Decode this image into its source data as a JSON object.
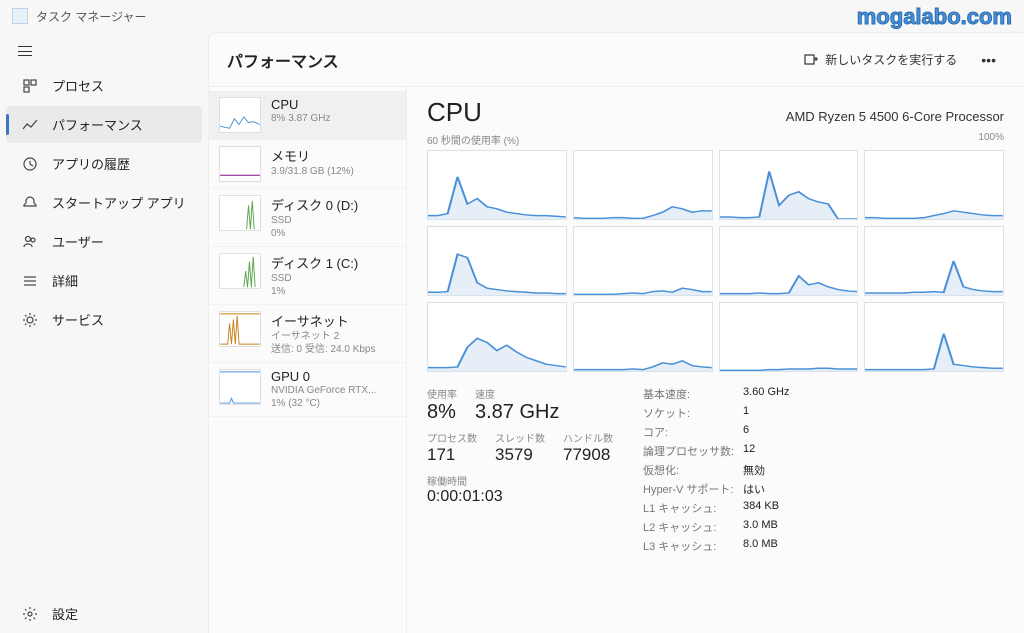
{
  "watermark": "mogalabo.com",
  "titlebar": {
    "title": "タスク マネージャー"
  },
  "sidebar": {
    "items": [
      {
        "label": "プロセス"
      },
      {
        "label": "パフォーマンス"
      },
      {
        "label": "アプリの履歴"
      },
      {
        "label": "スタートアップ アプリ"
      },
      {
        "label": "ユーザー"
      },
      {
        "label": "詳細"
      },
      {
        "label": "サービス"
      }
    ],
    "settings": "設定"
  },
  "header": {
    "title": "パフォーマンス",
    "new_task": "新しいタスクを実行する"
  },
  "resources": [
    {
      "name": "CPU",
      "sub": "8%  3.87 GHz"
    },
    {
      "name": "メモリ",
      "sub": "3.9/31.8 GB (12%)"
    },
    {
      "name": "ディスク 0 (D:)",
      "sub1": "SSD",
      "sub2": "0%"
    },
    {
      "name": "ディスク 1 (C:)",
      "sub1": "SSD",
      "sub2": "1%"
    },
    {
      "name": "イーサネット",
      "sub1": "イーサネット 2",
      "sub2": "送信: 0 受信: 24.0 Kbps"
    },
    {
      "name": "GPU 0",
      "sub1": "NVIDIA GeForce RTX...",
      "sub2": "1% (32 °C)"
    }
  ],
  "detail": {
    "title": "CPU",
    "model": "AMD Ryzen 5 4500 6-Core Processor",
    "graph_left": "60 秒間の使用率 (%)",
    "graph_right": "100%",
    "big_stats": [
      {
        "label": "使用率",
        "value": "8%"
      },
      {
        "label": "速度",
        "value": "3.87 GHz"
      }
    ],
    "mid_stats": [
      {
        "label": "プロセス数",
        "value": "171"
      },
      {
        "label": "スレッド数",
        "value": "3579"
      },
      {
        "label": "ハンドル数",
        "value": "77908"
      }
    ],
    "uptime_label": "稼働時間",
    "uptime_value": "0:00:01:03",
    "specs": [
      {
        "key": "基本速度:",
        "val": "3.60 GHz"
      },
      {
        "key": "ソケット:",
        "val": "1"
      },
      {
        "key": "コア:",
        "val": "6"
      },
      {
        "key": "論理プロセッサ数:",
        "val": "12"
      },
      {
        "key": "仮想化:",
        "val": "無効"
      },
      {
        "key": "Hyper-V サポート:",
        "val": "はい"
      },
      {
        "key": "L1 キャッシュ:",
        "val": "384 KB"
      },
      {
        "key": "L2 キャッシュ:",
        "val": "3.0 MB"
      },
      {
        "key": "L3 キャッシュ:",
        "val": "8.0 MB"
      }
    ]
  },
  "chart_data": {
    "type": "line",
    "title": "CPU per-core usage over 60 seconds",
    "xlabel": "seconds",
    "ylabel": "usage %",
    "ylim": [
      0,
      100
    ],
    "series": [
      {
        "name": "Core 0",
        "values": [
          5,
          5,
          8,
          62,
          22,
          30,
          18,
          15,
          10,
          8,
          6,
          5,
          5,
          4,
          3
        ]
      },
      {
        "name": "Core 1",
        "values": [
          2,
          1,
          1,
          1,
          2,
          2,
          1,
          1,
          5,
          10,
          18,
          15,
          10,
          12,
          12
        ]
      },
      {
        "name": "Core 2",
        "values": [
          3,
          3,
          2,
          2,
          3,
          70,
          20,
          35,
          40,
          30,
          25,
          22,
          0,
          0,
          0
        ]
      },
      {
        "name": "Core 3",
        "values": [
          2,
          2,
          1,
          1,
          1,
          1,
          2,
          5,
          8,
          12,
          10,
          8,
          6,
          5,
          5
        ]
      },
      {
        "name": "Core 4",
        "values": [
          4,
          4,
          5,
          60,
          55,
          18,
          10,
          8,
          6,
          5,
          4,
          3,
          3,
          2,
          2
        ]
      },
      {
        "name": "Core 5",
        "values": [
          1,
          1,
          1,
          1,
          1,
          2,
          3,
          2,
          5,
          6,
          4,
          10,
          8,
          5,
          5
        ]
      },
      {
        "name": "Core 6",
        "values": [
          2,
          2,
          2,
          2,
          3,
          2,
          2,
          3,
          28,
          15,
          18,
          12,
          8,
          6,
          5
        ]
      },
      {
        "name": "Core 7",
        "values": [
          3,
          3,
          3,
          3,
          3,
          4,
          4,
          5,
          4,
          50,
          12,
          8,
          6,
          5,
          5
        ]
      },
      {
        "name": "Core 8",
        "values": [
          5,
          5,
          5,
          6,
          35,
          48,
          42,
          30,
          38,
          28,
          20,
          15,
          10,
          8,
          6
        ]
      },
      {
        "name": "Core 9",
        "values": [
          2,
          2,
          2,
          2,
          2,
          2,
          3,
          2,
          6,
          12,
          10,
          15,
          8,
          6,
          5
        ]
      },
      {
        "name": "Core 10",
        "values": [
          1,
          1,
          1,
          1,
          1,
          2,
          2,
          3,
          3,
          3,
          4,
          4,
          3,
          3,
          3
        ]
      },
      {
        "name": "Core 11",
        "values": [
          2,
          2,
          2,
          2,
          2,
          2,
          2,
          3,
          55,
          10,
          8,
          6,
          5,
          4,
          4
        ]
      }
    ]
  }
}
